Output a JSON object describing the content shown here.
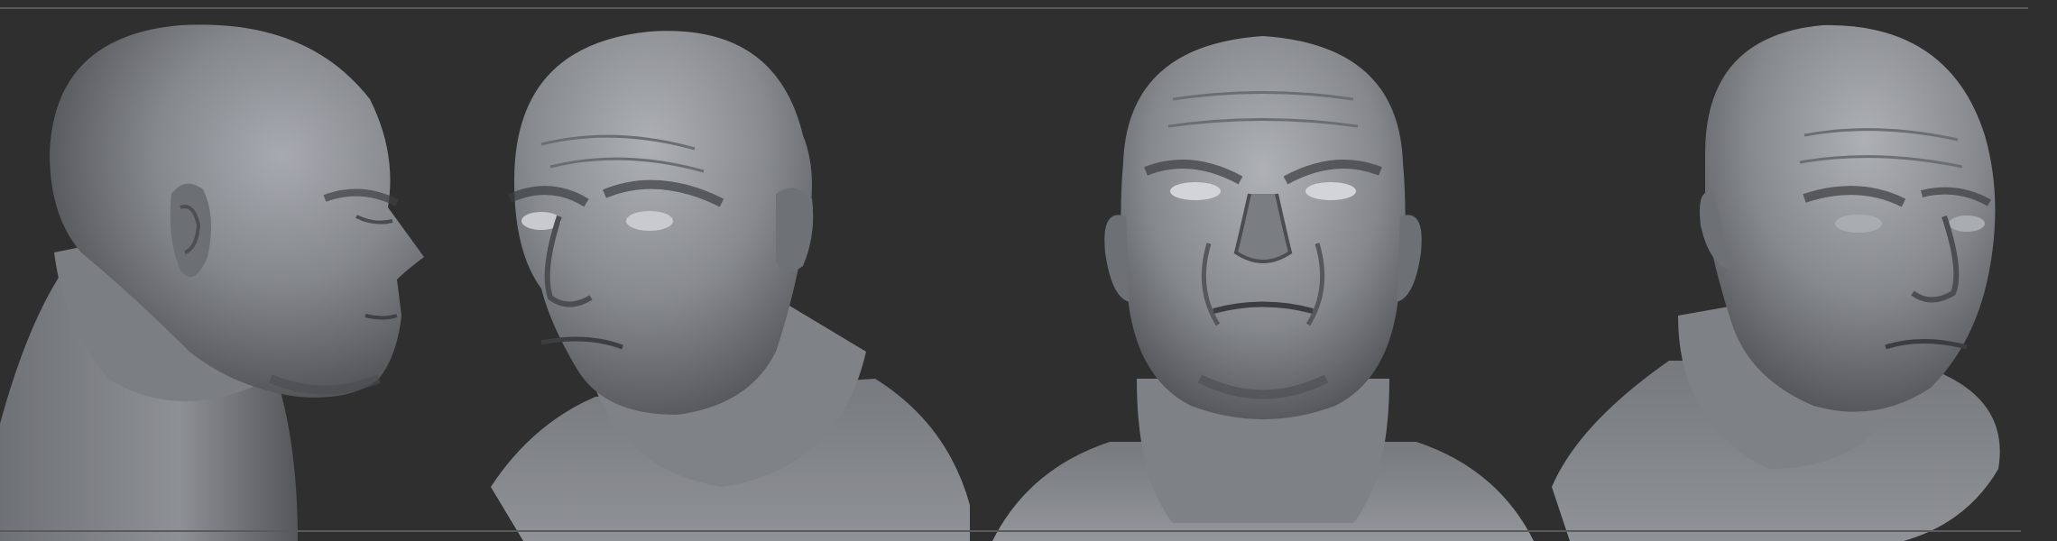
{
  "scene": {
    "background_color": "#2f2f2f",
    "rule_color": "#5a5a5a",
    "clay_color": "#8a8d92",
    "views": [
      {
        "name": "left-profile-view"
      },
      {
        "name": "three-quarter-left-view"
      },
      {
        "name": "front-view"
      },
      {
        "name": "three-quarter-right-view"
      }
    ]
  }
}
